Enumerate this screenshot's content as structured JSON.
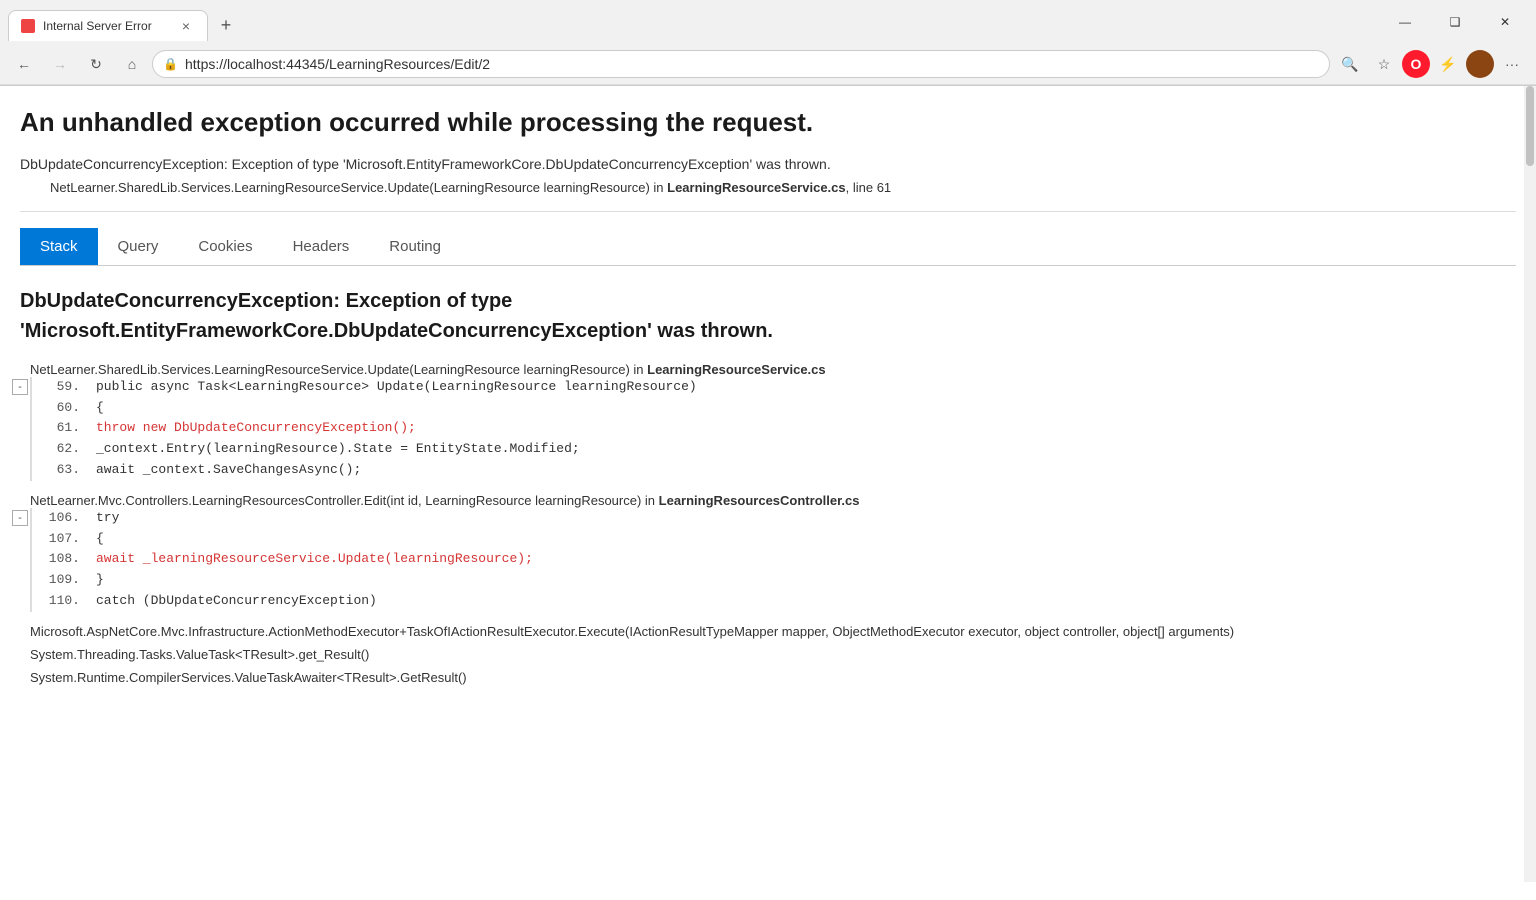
{
  "browser": {
    "tab_title": "Internal Server Error",
    "tab_close": "×",
    "new_tab": "+",
    "window_controls": {
      "minimize": "—",
      "maximize": "❑",
      "close": "✕"
    },
    "nav": {
      "back": "←",
      "forward": "→",
      "refresh": "↻",
      "home": "⌂",
      "lock_icon": "🔒",
      "url": "https://localhost:44345/LearningResources/Edit/2",
      "search_icon": "🔍",
      "favorite_icon": "☆",
      "opera_label": "O",
      "more": "···"
    }
  },
  "page": {
    "main_title": "An unhandled exception occurred while processing the request.",
    "exception_type": "DbUpdateConcurrencyException: Exception of type 'Microsoft.EntityFrameworkCore.DbUpdateConcurrencyException' was thrown.",
    "stack_source": "NetLearner.SharedLib.Services.LearningResourceService.Update(LearningResource learningResource) in",
    "stack_source_file": "LearningResourceService.cs",
    "stack_source_line": ", line 61",
    "tabs": [
      {
        "label": "Stack",
        "active": true
      },
      {
        "label": "Query",
        "active": false
      },
      {
        "label": "Cookies",
        "active": false
      },
      {
        "label": "Headers",
        "active": false
      },
      {
        "label": "Routing",
        "active": false
      }
    ],
    "exception_heading_line1": "DbUpdateConcurrencyException: Exception of type",
    "exception_heading_line2": "'Microsoft.EntityFrameworkCore.DbUpdateConcurrencyException' was thrown.",
    "stack_frames": [
      {
        "source": "NetLearner.SharedLib.Services.LearningResourceService.Update(LearningResource learningResource) in",
        "source_file": "LearningResourceService.cs",
        "source_file_bold": true,
        "collapse_label": "-",
        "lines": [
          {
            "num": "59.",
            "code": "   public async Task<LearningResource> Update(LearningResource learningResource)",
            "highlighted": false
          },
          {
            "num": "60.",
            "code": "   {",
            "highlighted": false
          },
          {
            "num": "61.",
            "code": "      throw new DbUpdateConcurrencyException();",
            "highlighted": true
          },
          {
            "num": "62.",
            "code": "      _context.Entry(learningResource).State = EntityState.Modified;",
            "highlighted": false
          },
          {
            "num": "63.",
            "code": "      await _context.SaveChangesAsync();",
            "highlighted": false
          }
        ]
      },
      {
        "source": "NetLearner.Mvc.Controllers.LearningResourcesController.Edit(int id, LearningResource learningResource) in",
        "source_file": "LearningResourcesController.cs",
        "source_file_bold": true,
        "collapse_label": "-",
        "lines": [
          {
            "num": "106.",
            "code": "   try",
            "highlighted": false
          },
          {
            "num": "107.",
            "code": "   {",
            "highlighted": false
          },
          {
            "num": "108.",
            "code": "      await _learningResourceService.Update(learningResource);",
            "highlighted": true
          },
          {
            "num": "109.",
            "code": "   }",
            "highlighted": false
          },
          {
            "num": "110.",
            "code": "   catch (DbUpdateConcurrencyException)",
            "highlighted": false
          }
        ]
      }
    ],
    "additional_frames": [
      "Microsoft.AspNetCore.Mvc.Infrastructure.ActionMethodExecutor+TaskOfIActionResultExecutor.Execute(IActionResultTypeMapper mapper, ObjectMethodExecutor executor, object controller, object[] arguments)",
      "System.Threading.Tasks.ValueTask<TResult>.get_Result()",
      "System.Runtime.CompilerServices.ValueTaskAwaiter<TResult>.GetResult()"
    ]
  }
}
